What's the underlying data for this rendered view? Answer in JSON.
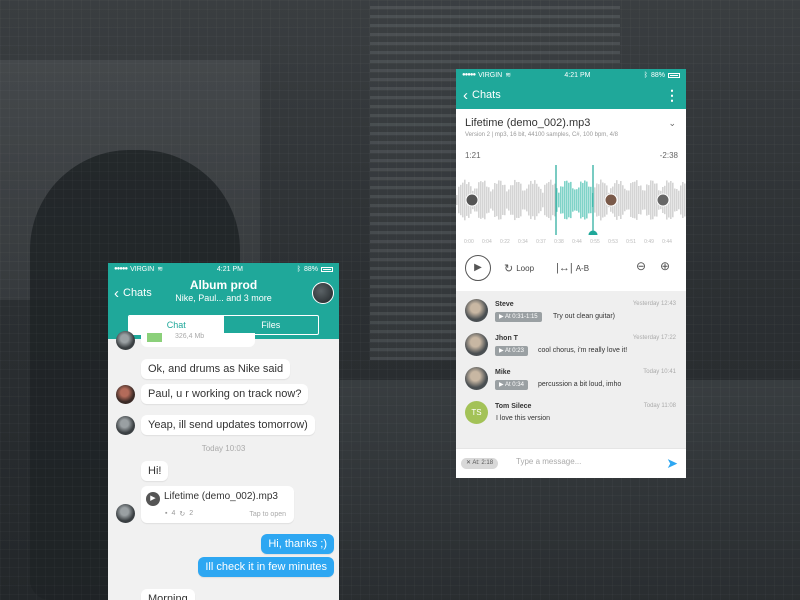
{
  "left_phone": {
    "status": {
      "carrier": "VIRGIN",
      "time": "4:21 PM",
      "battery": "88%"
    },
    "header": {
      "back_label": "Chats",
      "title": "Album prod",
      "subtitle": "Nike, Paul... and 3 more"
    },
    "tabs": [
      {
        "label": "Chat",
        "active": true
      },
      {
        "label": "Files",
        "active": false
      }
    ],
    "prev_file_size": "326,4 Mb",
    "messages": [
      {
        "text": "Ok, and drums as Nike said",
        "from_me": false
      },
      {
        "text": "Paul, u r working on track now?",
        "from_me": false
      },
      {
        "text": "Yeap, ill send updates tomorrow)",
        "from_me": false
      },
      {
        "text": "Hi!",
        "from_me": false
      },
      {
        "text": "Hi, thanks ;)",
        "from_me": true
      },
      {
        "text": "Ill check it in few minutes",
        "from_me": true
      },
      {
        "text": "Morning",
        "from_me": false
      }
    ],
    "day_label": "Today 10:03",
    "file_card": {
      "name": "Lifetime (demo_002).mp3",
      "comments": "4",
      "versions": "2",
      "tap": "Tap to open"
    }
  },
  "right_phone": {
    "status": {
      "carrier": "VIRGIN",
      "time": "4:21 PM",
      "battery": "88%"
    },
    "header": {
      "back_label": "Chats"
    },
    "track": {
      "name": "Lifetime (demo_002).mp3",
      "meta": "Version 2 | mp3, 16 bit, 44100 samples, C#, 100 bpm, 4/8",
      "elapsed": "1:21",
      "remaining": "-2:38",
      "timeline": [
        "0:00",
        "0:04",
        "0:22",
        "0:34",
        "0:37",
        "0:38",
        "0:44",
        "0:55",
        "0:53",
        "0:51",
        "0:49",
        "0:44"
      ]
    },
    "controls": {
      "loop_label": "Loop",
      "ab_label": "A-B"
    },
    "comments": [
      {
        "name": "Steve",
        "time": "Yesterday 12:43",
        "at": "At 0:31-1:15",
        "text": "Try out clean guitar)"
      },
      {
        "name": "Jhon T",
        "time": "Yesterday 17:22",
        "at": "At 0:23",
        "text": "cool chorus, i'm really love it!"
      },
      {
        "name": "Mike",
        "time": "Today 10:41",
        "at": "At 0:34",
        "text": "percussion a bit loud, imho"
      },
      {
        "name": "Tom Silece",
        "time": "Today 11:08",
        "initials": "TS",
        "text": "I love this version"
      }
    ],
    "input": {
      "chip": "At: 2:18",
      "placeholder": "Type a message..."
    }
  },
  "colors": {
    "teal": "#1fa89a",
    "blue_bubble": "#2ea7f2",
    "avatar_green": "#a3c257"
  }
}
